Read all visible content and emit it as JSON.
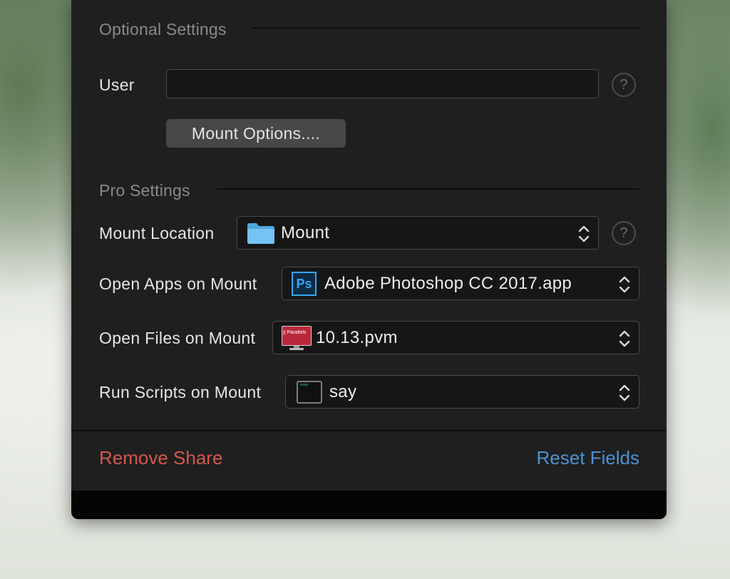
{
  "optional_settings": {
    "title": "Optional Settings",
    "user_label": "User",
    "user_value": "",
    "help_glyph": "?",
    "mount_options_button": "Mount Options...."
  },
  "pro_settings": {
    "title": "Pro Settings",
    "rows": [
      {
        "label": "Mount Location",
        "value": "Mount",
        "icon": "folder-icon"
      },
      {
        "label": "Open Apps on Mount",
        "value": "Adobe Photoshop CC 2017.app",
        "icon": "photoshop-icon",
        "icon_text": "Ps"
      },
      {
        "label": "Open Files on Mount",
        "value": "10.13.pvm",
        "icon": "parallels-vm-icon",
        "icon_text": "|| Parallels"
      },
      {
        "label": "Run Scripts on Mount",
        "value": "say",
        "icon": "terminal-icon",
        "icon_text": "exec"
      }
    ]
  },
  "footer": {
    "remove_label": "Remove Share",
    "reset_label": "Reset Fields"
  },
  "colors": {
    "panel": "#1f1f1f",
    "destructive": "#d4584f",
    "accent": "#4a93d2"
  }
}
